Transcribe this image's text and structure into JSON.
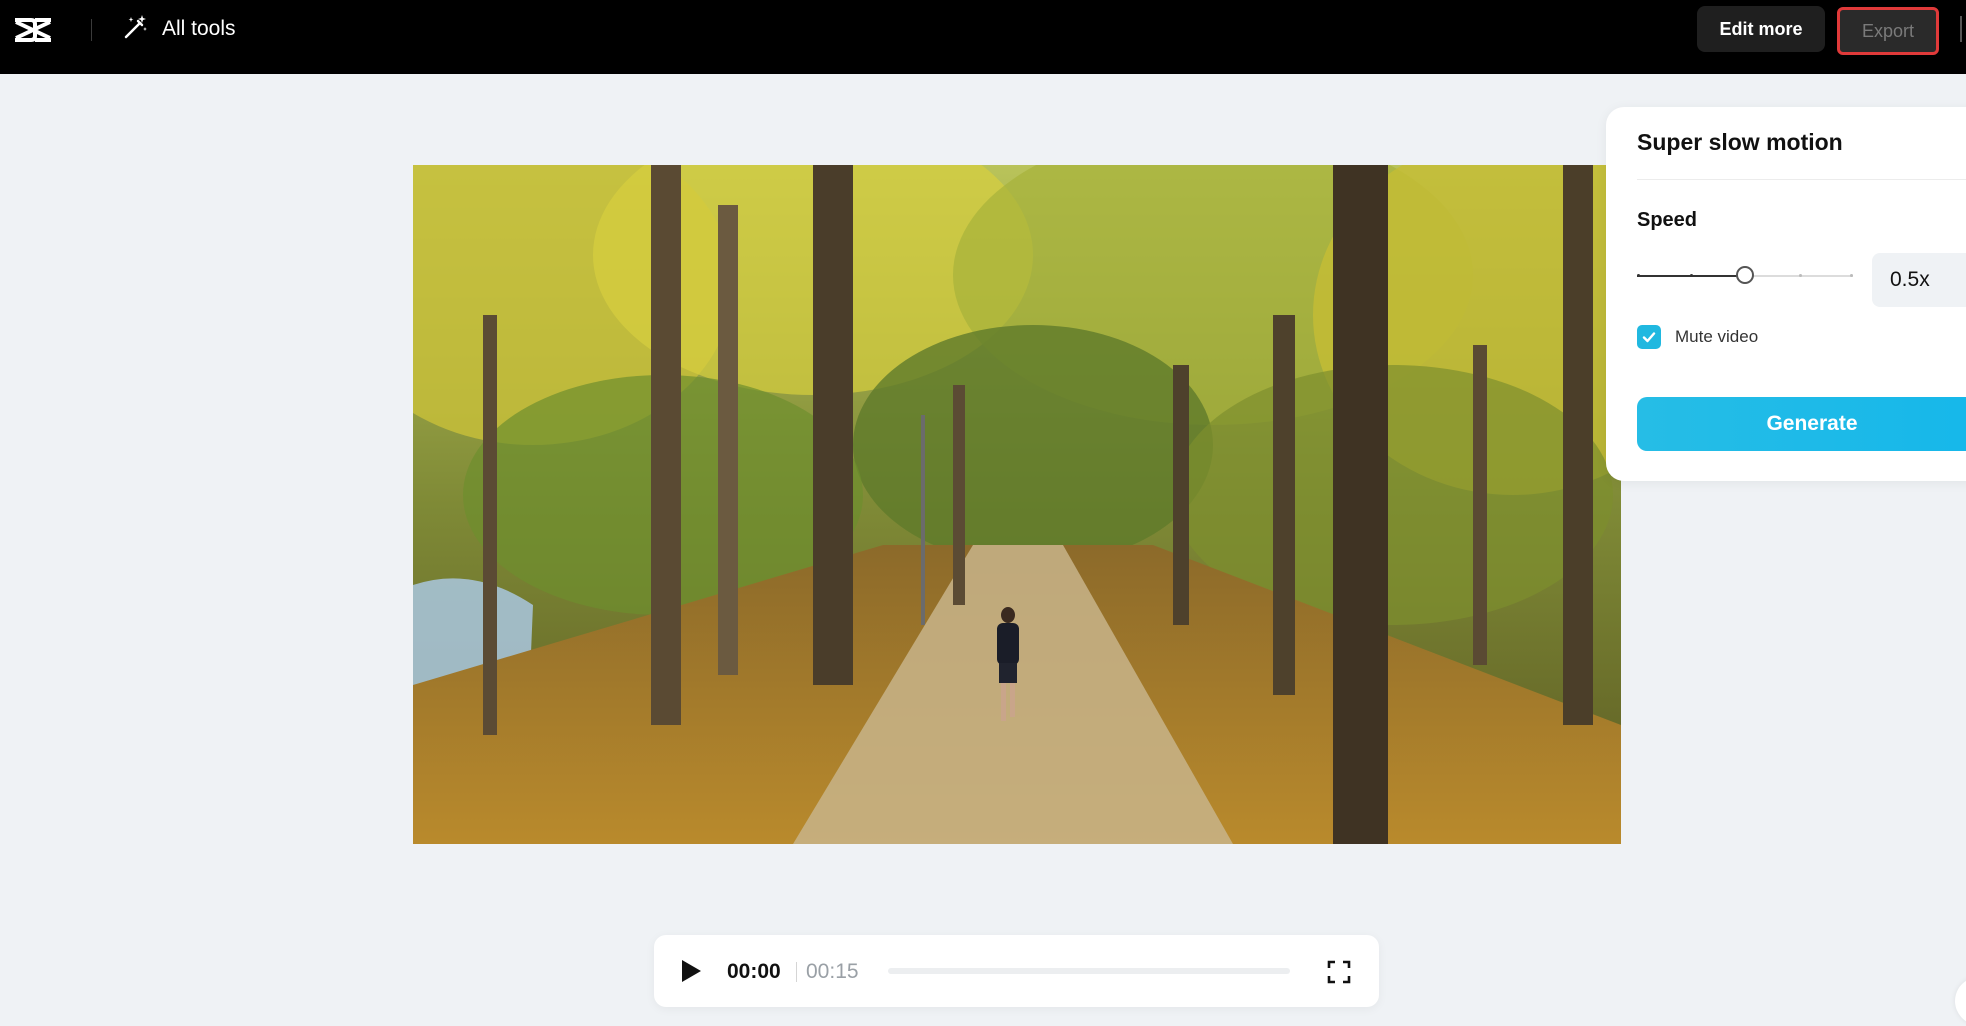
{
  "topbar": {
    "logo_icon": "capcut-logo-icon",
    "all_tools_icon": "magic-wand-icon",
    "all_tools_label": "All tools",
    "edit_more_label": "Edit more",
    "export_label": "Export"
  },
  "panel": {
    "title": "Super slow motion",
    "speed_label": "Speed",
    "speed_value": "0.5x",
    "speed_slider_level": 0.5,
    "mute_label": "Mute video",
    "mute_checked": true,
    "generate_label": "Generate"
  },
  "player": {
    "play_icon": "play-icon",
    "current_time": "00:00",
    "total_time": "00:15",
    "progress": 0,
    "fullscreen_icon": "fullscreen-icon"
  },
  "colors": {
    "topbar_bg": "#000000",
    "canvas_bg": "#eff2f5",
    "accent": "#20b8e0",
    "export_highlight": "#e03a3a"
  }
}
